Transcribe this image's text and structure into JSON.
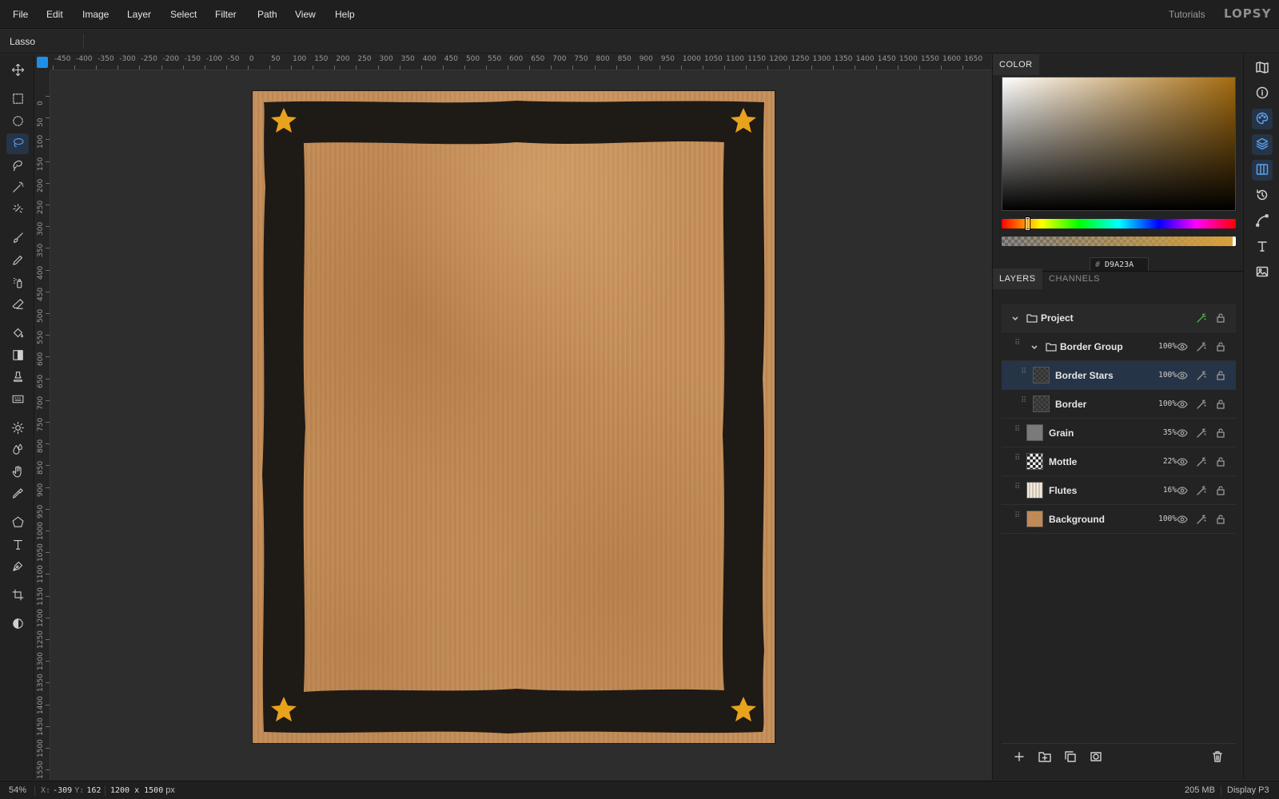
{
  "menu": [
    "File",
    "Edit",
    "Image",
    "Layer",
    "Select",
    "Filter",
    "Path",
    "View",
    "Help"
  ],
  "header": {
    "tutorials": "Tutorials",
    "logo": "LOPSY"
  },
  "options_bar": {
    "tool_name": "Lasso"
  },
  "rulers": {
    "horizontal": [
      "-450",
      "-400",
      "-350",
      "-300",
      "-250",
      "-200",
      "-150",
      "-100",
      "-50",
      "0",
      "50",
      "100",
      "150",
      "200",
      "250",
      "300",
      "350",
      "400",
      "450",
      "500",
      "550",
      "600",
      "650",
      "700",
      "750",
      "800",
      "850",
      "900",
      "950",
      "1000",
      "1050",
      "1100",
      "1150",
      "1200",
      "1250",
      "1300",
      "1350",
      "1400",
      "1450",
      "1500",
      "1550",
      "1600",
      "1650"
    ],
    "vertical": [
      "0",
      "50",
      "100",
      "150",
      "200",
      "250",
      "300",
      "350",
      "400",
      "450",
      "500",
      "550",
      "600",
      "650",
      "700",
      "750",
      "800",
      "850",
      "900",
      "950",
      "1000",
      "1050",
      "1100",
      "1150",
      "1200",
      "1250",
      "1300",
      "1350",
      "1400",
      "1450",
      "1500",
      "1550"
    ]
  },
  "colors": {
    "accent": "#1e8fe6",
    "selected_row": "#263447",
    "border_dark": "#1e1a16",
    "star": "#e8a21c",
    "kraft": "#c08a56"
  },
  "color_panel": {
    "title": "COLOR",
    "hex_label": "#",
    "hex_value": "D9A23A",
    "hue_position": 0.11,
    "alpha": 1.0
  },
  "layers_panel": {
    "tabs": [
      {
        "label": "LAYERS",
        "active": true
      },
      {
        "label": "CHANNELS",
        "active": false
      }
    ],
    "project": {
      "name": "Project"
    },
    "layers": [
      {
        "name": "Border Group",
        "opacity": "100%",
        "type": "group",
        "expanded": true
      },
      {
        "name": "Border Stars",
        "opacity": "100%",
        "type": "layer",
        "thumb": "checker",
        "selected": true
      },
      {
        "name": "Border",
        "opacity": "100%",
        "type": "layer",
        "thumb": "checker"
      },
      {
        "name": "Grain",
        "opacity": "35%",
        "type": "layer",
        "thumb": "grain"
      },
      {
        "name": "Mottle",
        "opacity": "22%",
        "type": "layer",
        "thumb": "mottle"
      },
      {
        "name": "Flutes",
        "opacity": "16%",
        "type": "layer",
        "thumb": "flutes"
      },
      {
        "name": "Background",
        "opacity": "100%",
        "type": "layer",
        "thumb": "bg"
      }
    ]
  },
  "tools": [
    "move-icon",
    "rect-select-icon",
    "ellipse-select-icon",
    "lasso-icon",
    "magnetic-lasso-icon",
    "magic-wand-icon",
    "quick-select-icon",
    "brush-icon",
    "pencil-icon",
    "spray-icon",
    "eraser-icon",
    "fill-icon",
    "gradient-icon",
    "stamp-icon",
    "pattern-icon",
    "dodge-icon",
    "blur-icon",
    "hand-icon",
    "eyedropper-icon",
    "polygon-icon",
    "text-icon",
    "pen-icon",
    "crop-icon",
    "contrast-icon"
  ],
  "active_tool": "lasso-icon",
  "panel_strip": [
    "navigator-icon",
    "info-icon",
    "color-icon",
    "layers-icon",
    "channels-icon",
    "history-icon",
    "paths-icon",
    "character-icon",
    "image-icon"
  ],
  "status": {
    "zoom": "54%",
    "x_label": "X:",
    "x_value": "-309",
    "y_label": "Y:",
    "y_value": "162",
    "doc_size": "1200 x 1500",
    "doc_unit": "px",
    "memory": "205 MB",
    "color_profile": "Display P3"
  }
}
